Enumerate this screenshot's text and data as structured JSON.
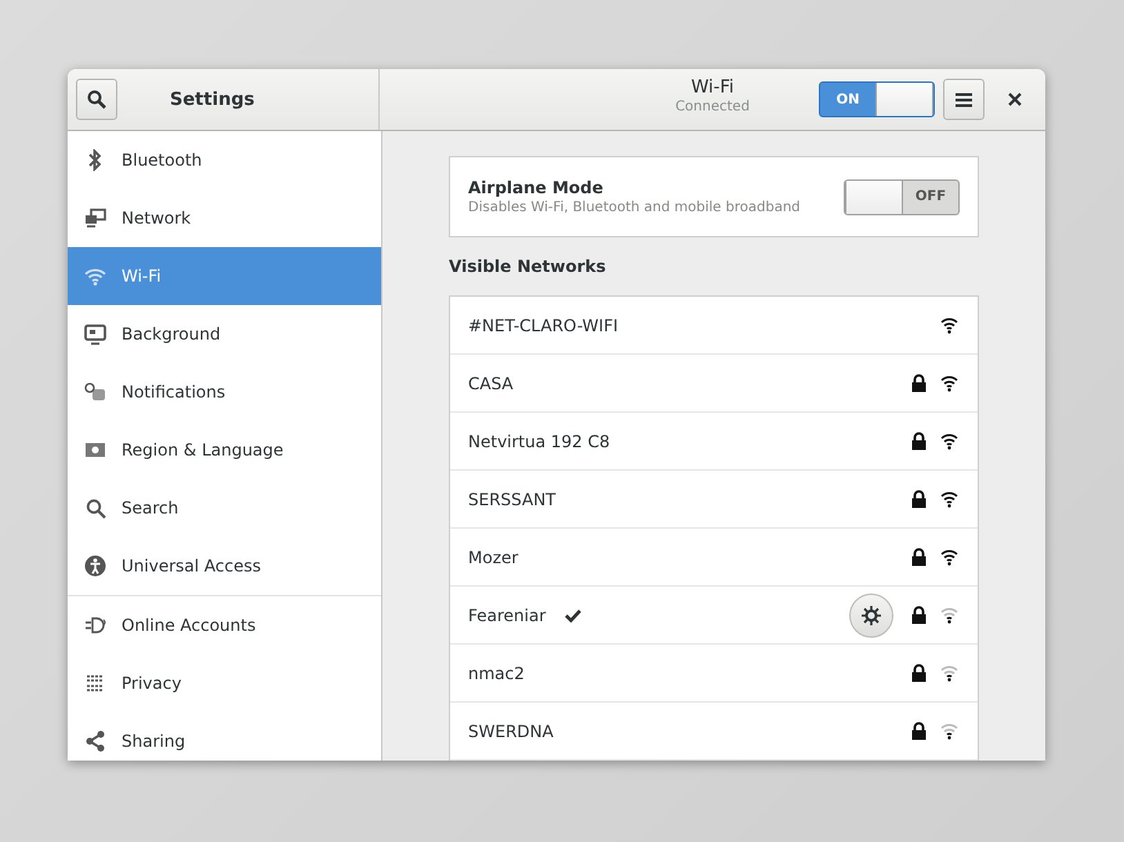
{
  "header": {
    "title": "Settings",
    "panel_title": "Wi-Fi",
    "panel_subtitle": "Connected",
    "wifi_switch": {
      "label": "ON",
      "on": true
    }
  },
  "sidebar": {
    "sections": [
      {
        "items": [
          {
            "label": "Bluetooth",
            "selected": false
          },
          {
            "label": "Network",
            "selected": false
          },
          {
            "label": "Wi-Fi",
            "selected": true
          },
          {
            "label": "Background",
            "selected": false
          },
          {
            "label": "Notifications",
            "selected": false
          },
          {
            "label": "Region & Language",
            "selected": false
          },
          {
            "label": "Search",
            "selected": false
          },
          {
            "label": "Universal Access",
            "selected": false
          }
        ]
      },
      {
        "items": [
          {
            "label": "Online Accounts",
            "selected": false
          },
          {
            "label": "Privacy",
            "selected": false
          },
          {
            "label": "Sharing",
            "selected": false
          }
        ]
      }
    ]
  },
  "airplane_mode": {
    "title": "Airplane Mode",
    "description": "Disables Wi-Fi, Bluetooth and mobile broadband",
    "switch": {
      "label": "OFF",
      "on": false
    }
  },
  "networks_heading": "Visible Networks",
  "networks": [
    {
      "name": "#NET-CLARO-WIFI",
      "secured": false,
      "connected": false,
      "weak_signal": false
    },
    {
      "name": "CASA",
      "secured": true,
      "connected": false,
      "weak_signal": false
    },
    {
      "name": "Netvirtua 192 C8",
      "secured": true,
      "connected": false,
      "weak_signal": false
    },
    {
      "name": "SERSSANT",
      "secured": true,
      "connected": false,
      "weak_signal": false
    },
    {
      "name": "Mozer",
      "secured": true,
      "connected": false,
      "weak_signal": false
    },
    {
      "name": "Feareniar",
      "secured": true,
      "connected": true,
      "weak_signal": true
    },
    {
      "name": "nmac2",
      "secured": true,
      "connected": false,
      "weak_signal": true
    },
    {
      "name": "SWERDNA",
      "secured": true,
      "connected": false,
      "weak_signal": true
    }
  ]
}
